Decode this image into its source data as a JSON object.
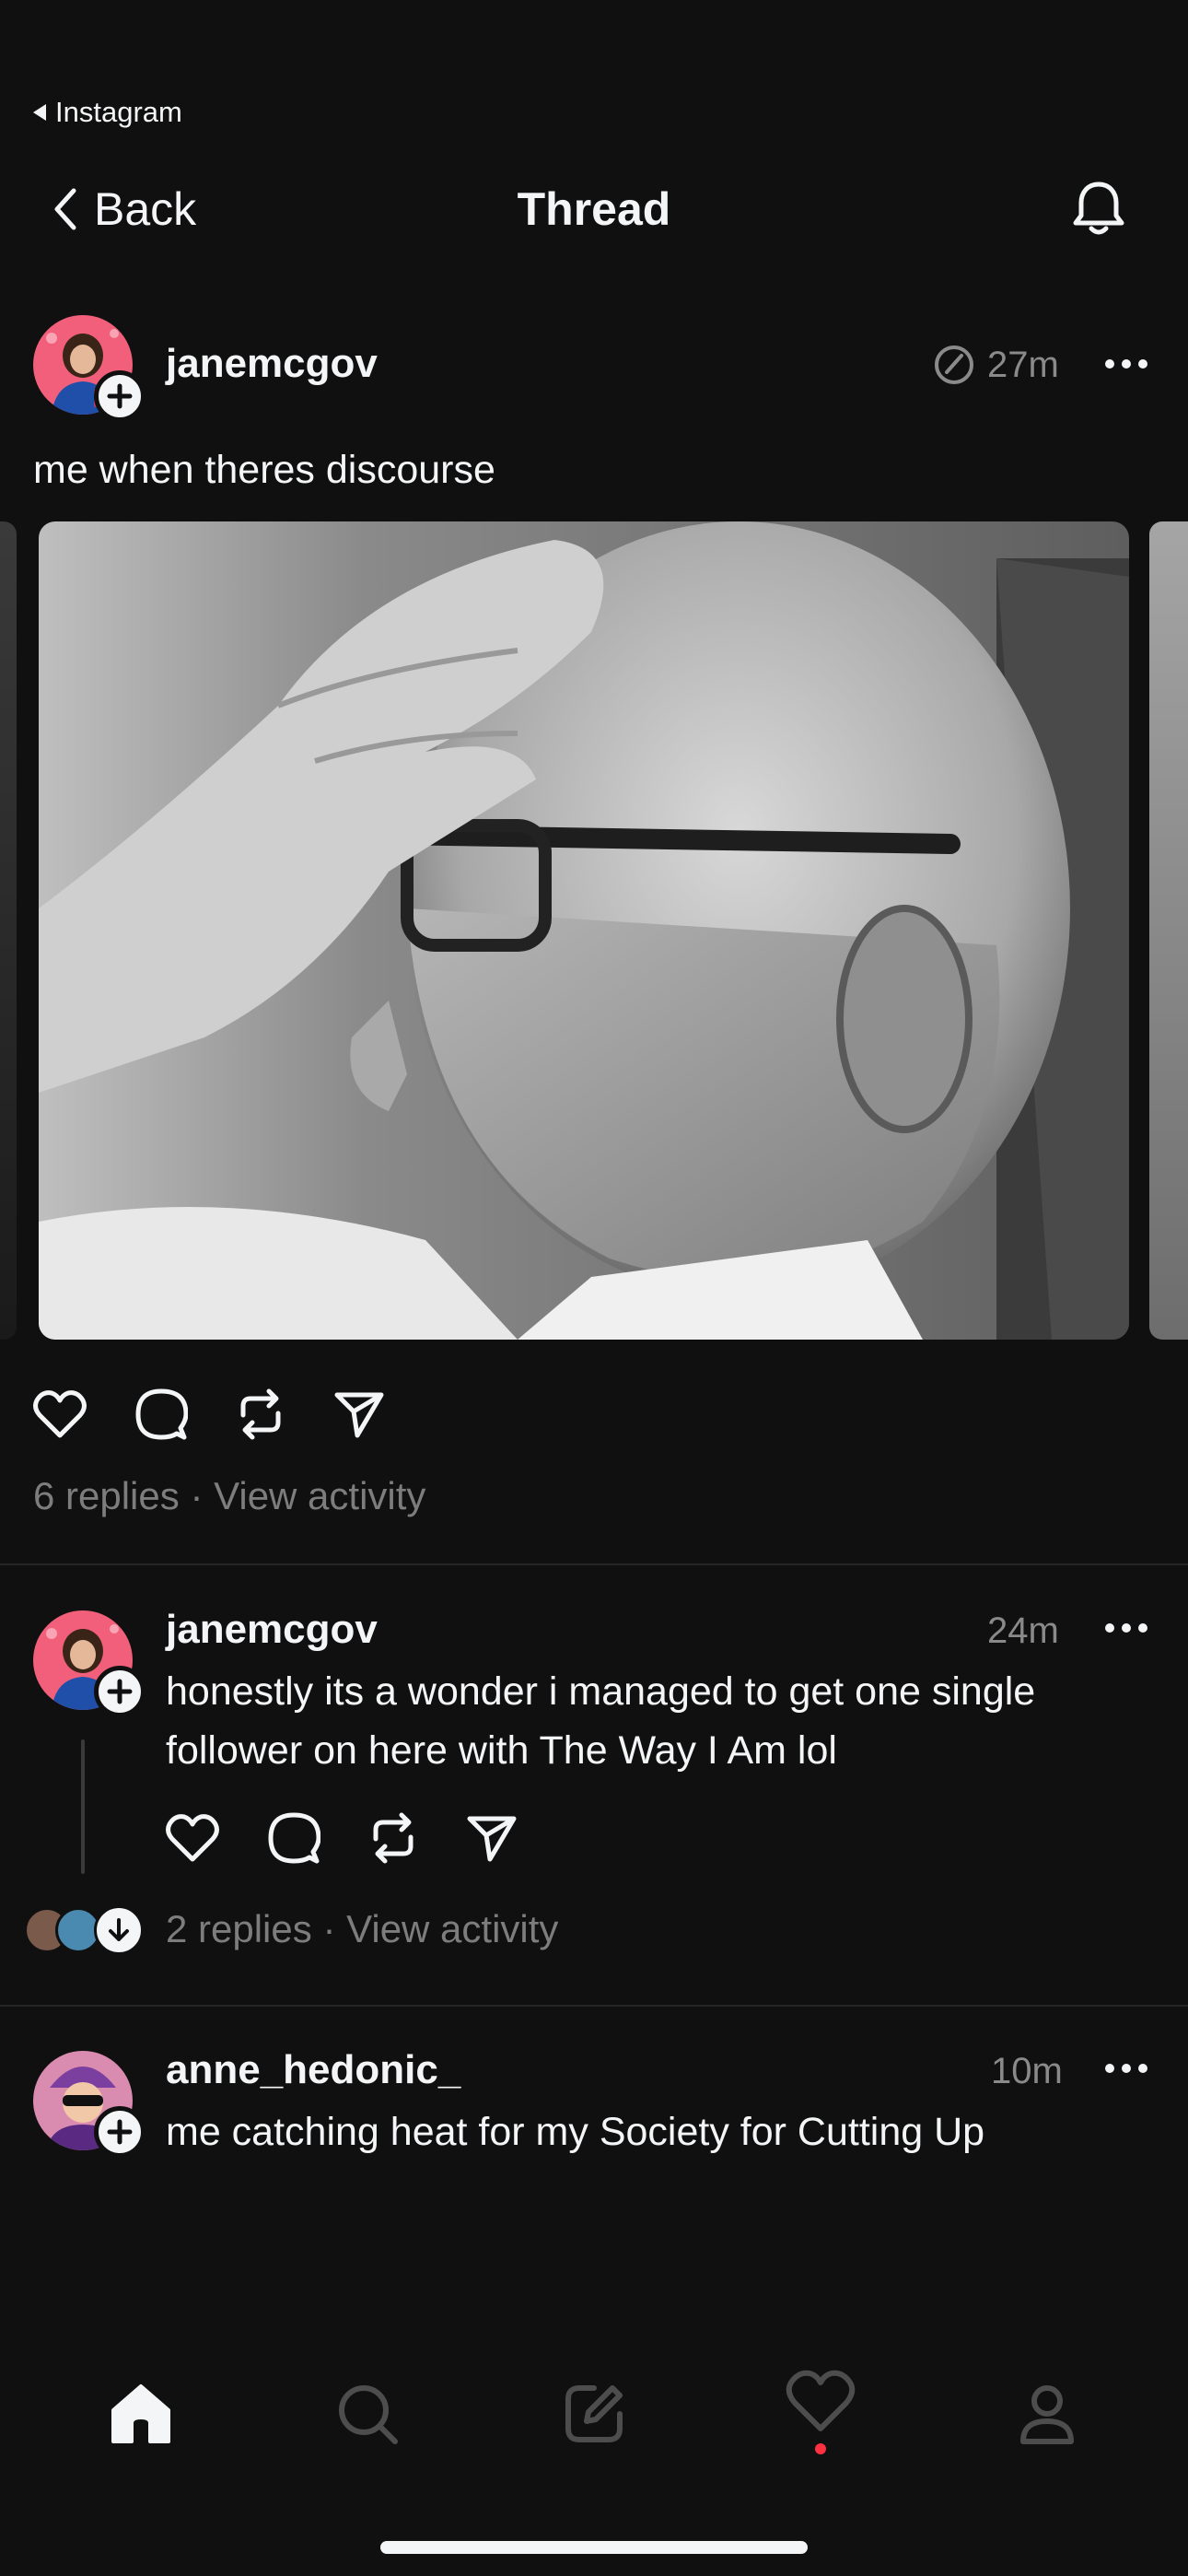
{
  "status": {
    "back_app": "Instagram"
  },
  "header": {
    "back_label": "Back",
    "title": "Thread"
  },
  "main_post": {
    "username": "janemcgov",
    "time": "27m",
    "text": "me when theres discourse",
    "photo_alt": "black and white portrait",
    "stats": {
      "replies": "6 replies",
      "separator": "·",
      "view_activity": "View activity"
    }
  },
  "reply_1": {
    "username": "janemcgov",
    "time": "24m",
    "text_line1": "honestly its a wonder i managed to get one single",
    "text_line2": "follower on here with The Way I Am lol",
    "stats": {
      "replies": "2 replies",
      "separator": "·",
      "view_activity": "View activity"
    }
  },
  "reply_2": {
    "username": "anne_hedonic_",
    "time": "10m",
    "text_line1": "me catching heat for my Society for Cutting Up"
  },
  "tabbar": {
    "items": [
      "home-icon",
      "search-icon",
      "compose-icon",
      "activity-heart-icon",
      "profile-icon"
    ],
    "notification_color": "#ff3040"
  },
  "colors": {
    "background": "#101010",
    "text": "#f3f5f7",
    "muted": "#7d7d7d",
    "divider": "#262626"
  }
}
